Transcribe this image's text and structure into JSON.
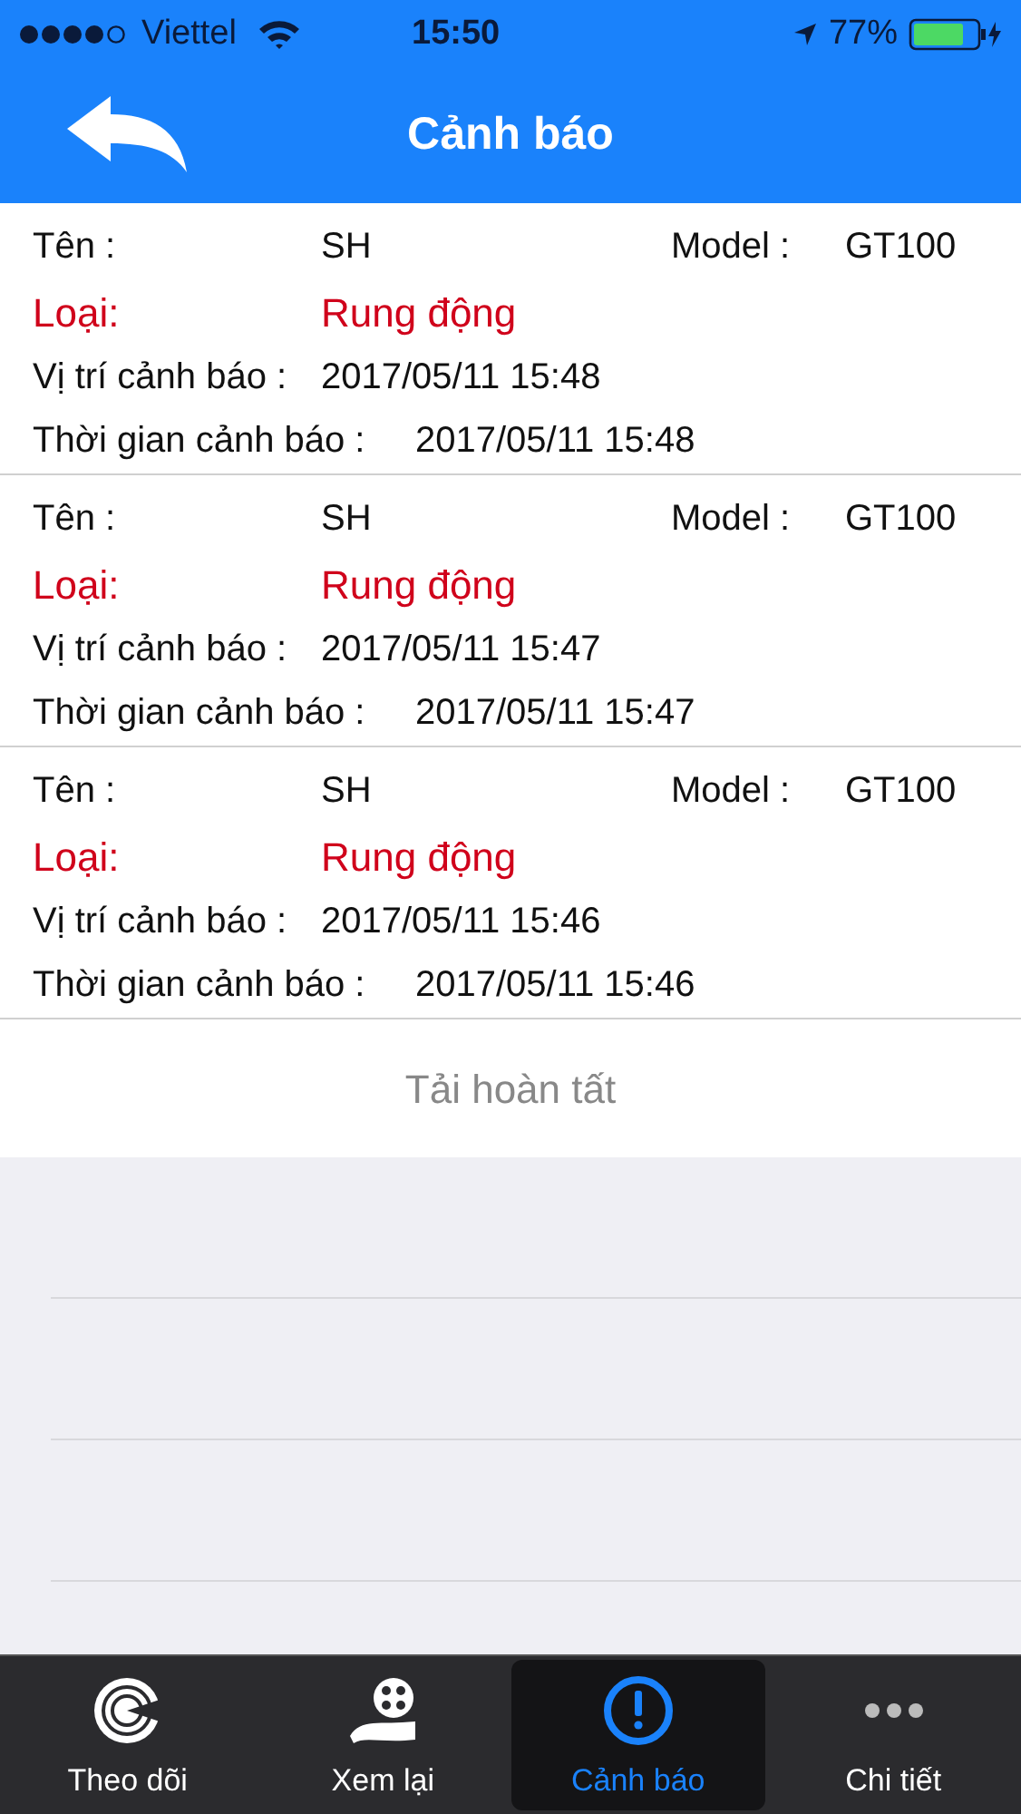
{
  "status_bar": {
    "carrier": "Viettel",
    "time": "15:50",
    "battery": "77%"
  },
  "header": {
    "title": "Cảnh báo"
  },
  "alerts": [
    {
      "name_label": "Tên :",
      "name": "SH",
      "model_label": "Model :",
      "model": "GT100",
      "type_label": "Loại:",
      "type": "Rung động",
      "location_label": "Vị trí cảnh báo :",
      "location": "2017/05/11 15:48",
      "time_label": "Thời gian cảnh báo :",
      "time": "2017/05/11 15:48"
    },
    {
      "name_label": "Tên :",
      "name": "SH",
      "model_label": "Model :",
      "model": "GT100",
      "type_label": "Loại:",
      "type": "Rung động",
      "location_label": "Vị trí cảnh báo :",
      "location": "2017/05/11 15:47",
      "time_label": "Thời gian cảnh báo :",
      "time": "2017/05/11 15:47"
    },
    {
      "name_label": "Tên :",
      "name": "SH",
      "model_label": "Model :",
      "model": "GT100",
      "type_label": "Loại:",
      "type": "Rung động",
      "location_label": "Vị trí cảnh báo :",
      "location": "2017/05/11 15:46",
      "time_label": "Thời gian cảnh báo :",
      "time": "2017/05/11 15:46"
    }
  ],
  "load_status": "Tải hoàn tất",
  "tabs": [
    {
      "kind": "radar",
      "label": "Theo dõi",
      "selected": false
    },
    {
      "kind": "film",
      "label": "Xem lại",
      "selected": false
    },
    {
      "kind": "alert",
      "label": "Cảnh báo",
      "selected": true
    },
    {
      "kind": "more",
      "label": "Chi tiết",
      "selected": false
    }
  ]
}
